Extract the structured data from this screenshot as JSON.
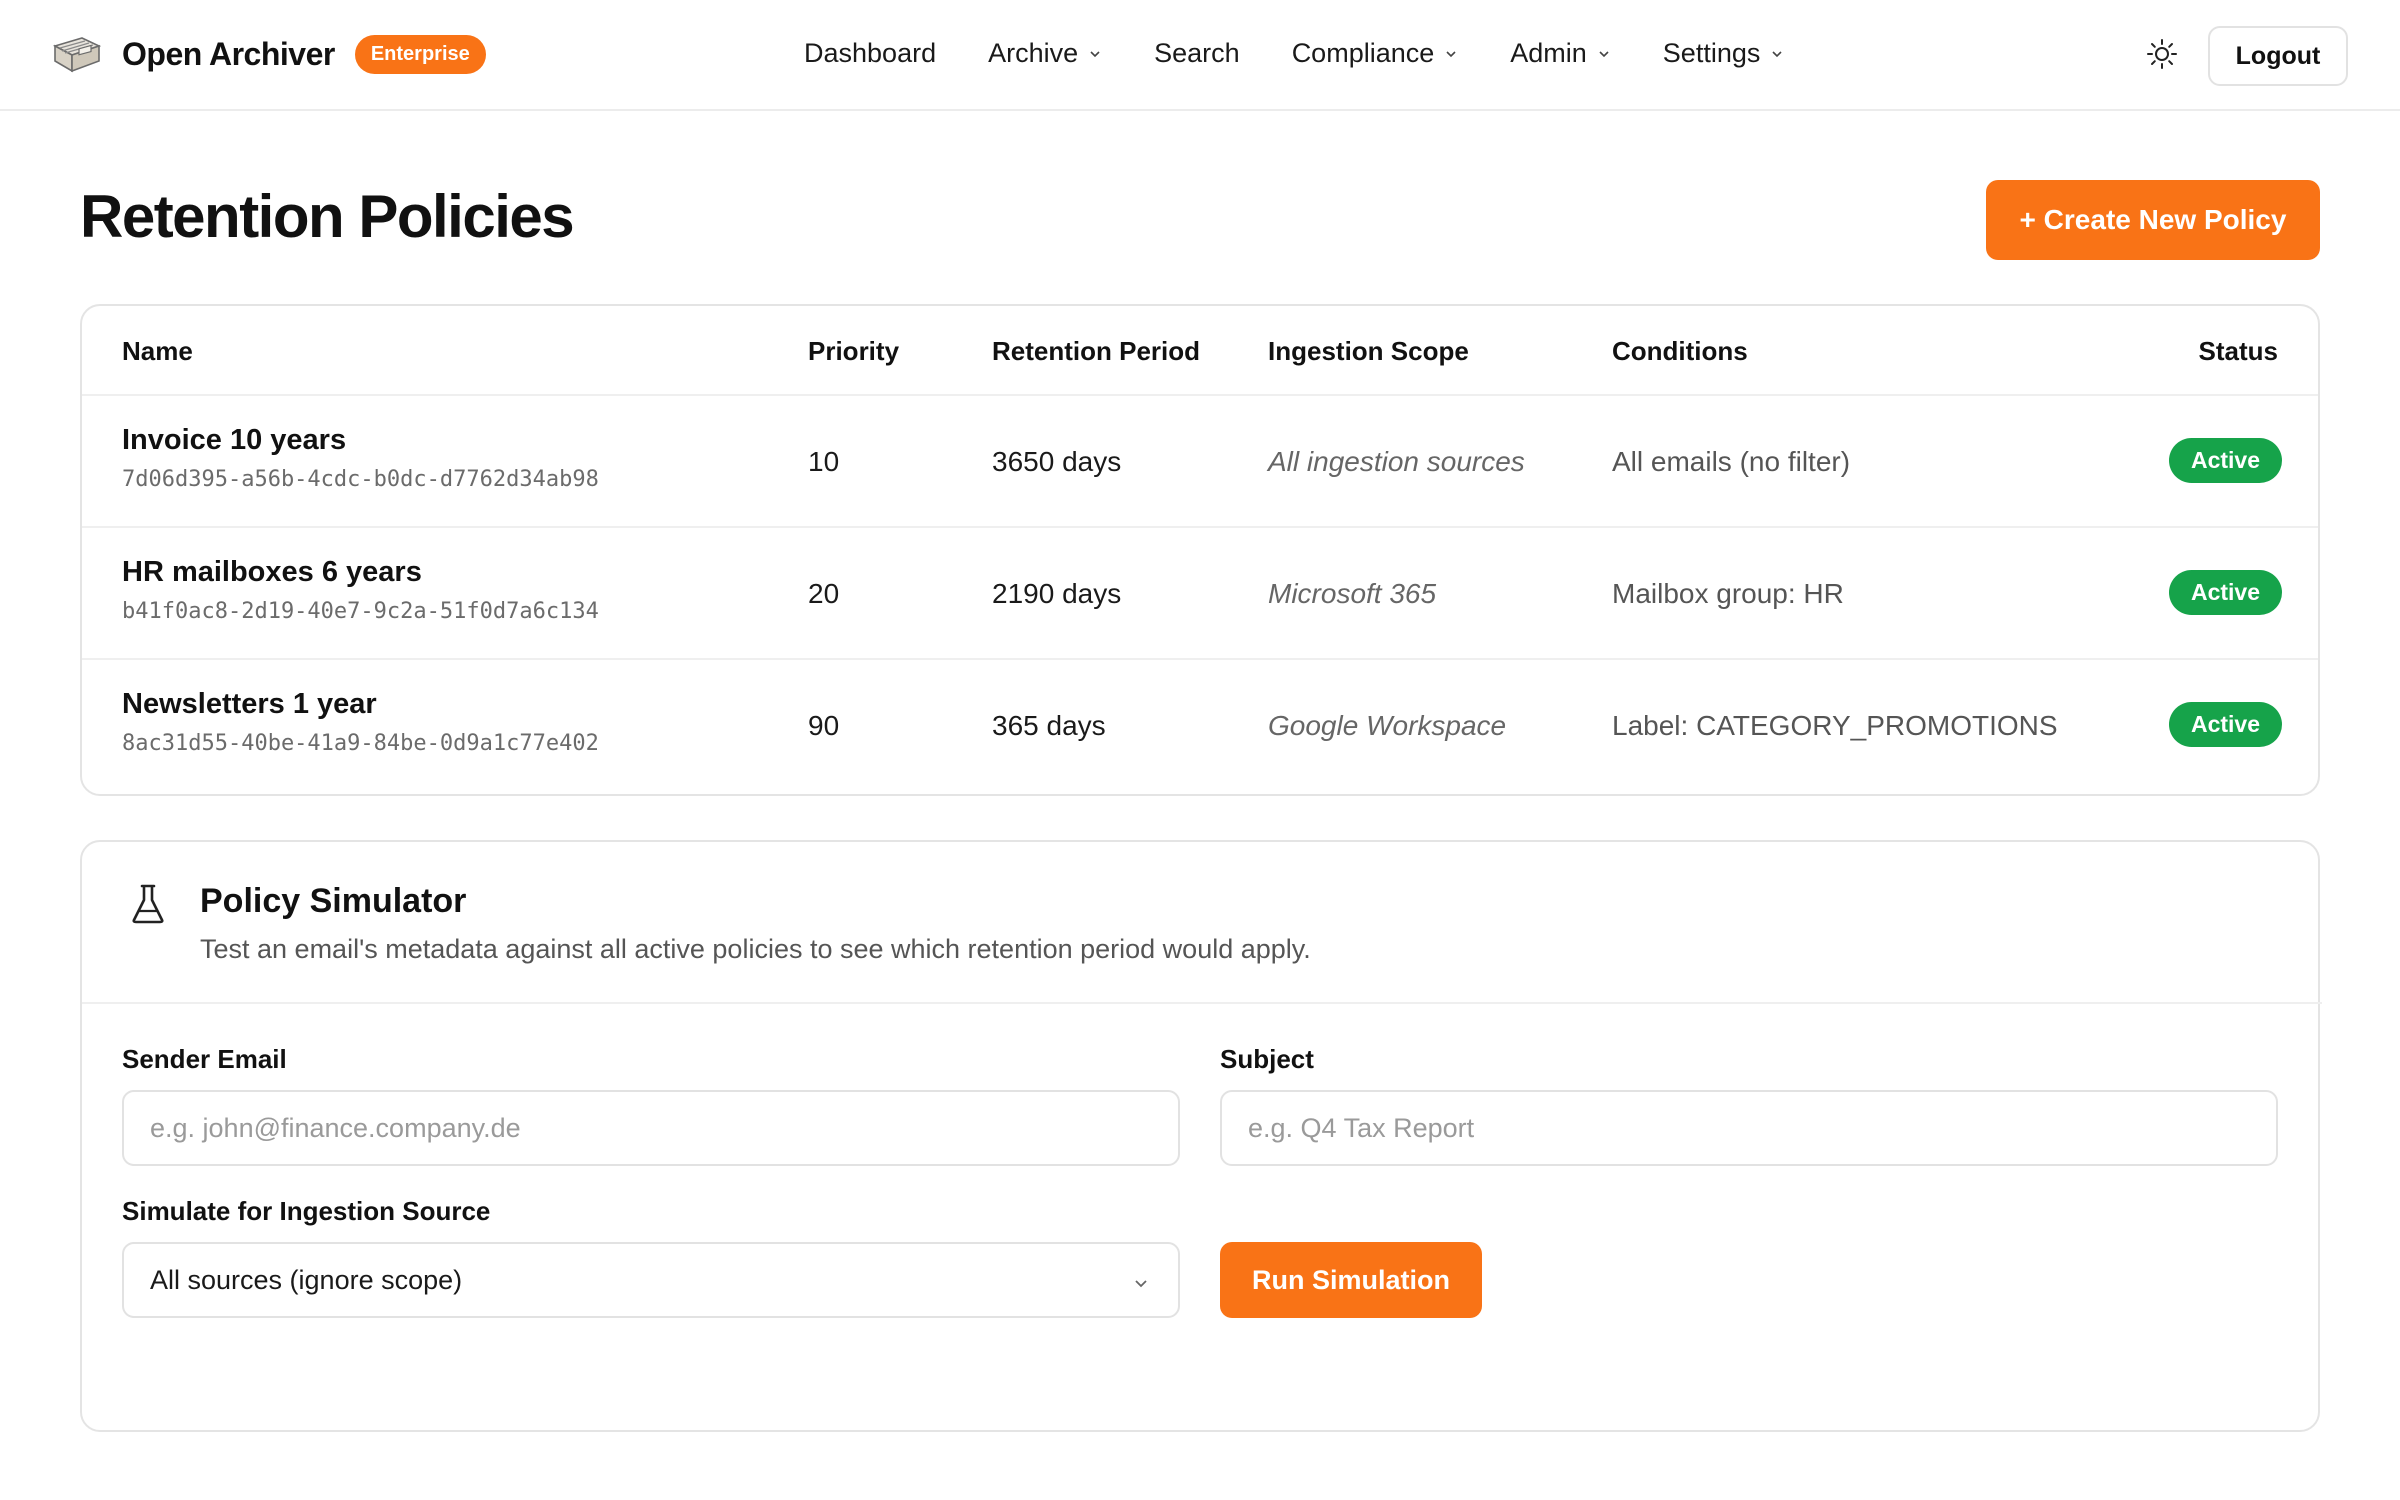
{
  "header": {
    "brand": "Open Archiver",
    "badge": "Enterprise",
    "nav": [
      {
        "label": "Dashboard",
        "dropdown": false
      },
      {
        "label": "Archive",
        "dropdown": true
      },
      {
        "label": "Search",
        "dropdown": false
      },
      {
        "label": "Compliance",
        "dropdown": true
      },
      {
        "label": "Admin",
        "dropdown": true
      },
      {
        "label": "Settings",
        "dropdown": true
      }
    ],
    "theme_icon": "sun-icon",
    "logout_label": "Logout"
  },
  "page": {
    "title": "Retention Policies",
    "create_label": "+ Create New Policy"
  },
  "table": {
    "columns": [
      "Name",
      "Priority",
      "Retention Period",
      "Ingestion Scope",
      "Conditions",
      "Status"
    ],
    "rows": [
      {
        "name": "Invoice 10 years",
        "id": "7d06d395-a56b-4cdc-b0dc-d7762d34ab98",
        "priority": "10",
        "period": "3650 days",
        "scope": "All ingestion sources",
        "conditions": "All emails (no filter)",
        "status": "Active"
      },
      {
        "name": "HR mailboxes 6 years",
        "id": "b41f0ac8-2d19-40e7-9c2a-51f0d7a6c134",
        "priority": "20",
        "period": "2190 days",
        "scope": "Microsoft 365",
        "conditions": "Mailbox group: HR",
        "status": "Active"
      },
      {
        "name": "Newsletters 1 year",
        "id": "8ac31d55-40be-41a9-84be-0d9a1c77e402",
        "priority": "90",
        "period": "365 days",
        "scope": "Google Workspace",
        "conditions": "Label: CATEGORY_PROMOTIONS",
        "status": "Active"
      }
    ]
  },
  "simulator": {
    "title": "Policy Simulator",
    "description": "Test an email's metadata against all active policies to see which retention period would apply.",
    "sender_label": "Sender Email",
    "sender_placeholder": "e.g. john@finance.company.de",
    "subject_label": "Subject",
    "subject_placeholder": "e.g. Q4 Tax Report",
    "source_label": "Simulate for Ingestion Source",
    "source_value": "All sources (ignore scope)",
    "run_label": "Run Simulation"
  },
  "colors": {
    "accent": "#f97316",
    "status_active": "#16a34a",
    "border": "#e4e4e4"
  }
}
